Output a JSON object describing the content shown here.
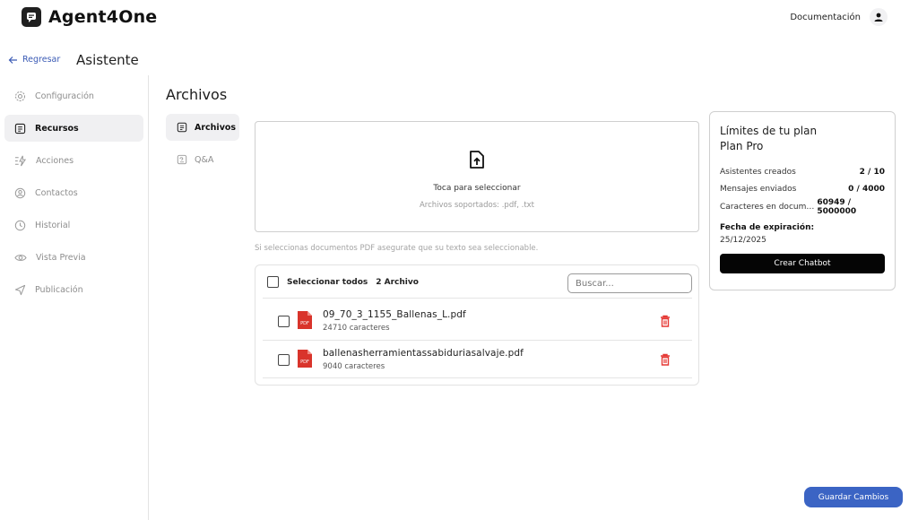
{
  "app": {
    "name": "Agent4One"
  },
  "header": {
    "docs_label": "Documentación",
    "user_icon": "person-icon"
  },
  "nav": {
    "back_label": "Regresar",
    "page_title": "Asistente"
  },
  "sidebar": {
    "items": [
      {
        "label": "Configuración",
        "icon": "gear-icon",
        "active": false
      },
      {
        "label": "Recursos",
        "icon": "document-icon",
        "active": true
      },
      {
        "label": "Acciones",
        "icon": "bolt-icon",
        "active": false
      },
      {
        "label": "Contactos",
        "icon": "contact-icon",
        "active": false
      },
      {
        "label": "Historial",
        "icon": "clock-icon",
        "active": false
      },
      {
        "label": "Vista Previa",
        "icon": "eye-icon",
        "active": false
      },
      {
        "label": "Publicación",
        "icon": "send-icon",
        "active": false
      }
    ]
  },
  "section": {
    "title": "Archivos",
    "tabs": [
      {
        "label": "Archivos",
        "active": true
      },
      {
        "label": "Q&A",
        "active": false
      }
    ]
  },
  "upload": {
    "title": "Toca para seleccionar",
    "subtitle": "Archivos soportados: .pdf, .txt",
    "hint": "Si seleccionas documentos PDF asegurate que su texto sea seleccionable."
  },
  "files": {
    "select_all_label": "Seleccionar todos",
    "count_label": "2 Archivo",
    "search_placeholder": "Buscar...",
    "items": [
      {
        "name": "09_70_3_1155_Ballenas_L.pdf",
        "chars": "24710 caracteres",
        "badge": "PDF"
      },
      {
        "name": "ballenasherramientassabiduriasalvaje.pdf",
        "chars": "9040 caracteres",
        "badge": "PDF"
      }
    ]
  },
  "plan": {
    "title": "Límites de tu plan",
    "plan_name": "Plan Pro",
    "rows": [
      {
        "label": "Asistentes creados",
        "value": "2 / 10"
      },
      {
        "label": "Mensajes enviados",
        "value": "0 / 4000"
      },
      {
        "label": "Caracteres en documentos",
        "value": "60949 / 5000000"
      }
    ],
    "expiry_label": "Fecha de expiración:",
    "expiry_date": "25/12/2025",
    "create_button": "Crear Chatbot"
  },
  "footer": {
    "save_button": "Guardar Cambios"
  },
  "colors": {
    "accent": "#3b64c4",
    "danger": "#e53935",
    "pdf_red": "#d9342b",
    "link": "#3b5bb5"
  }
}
